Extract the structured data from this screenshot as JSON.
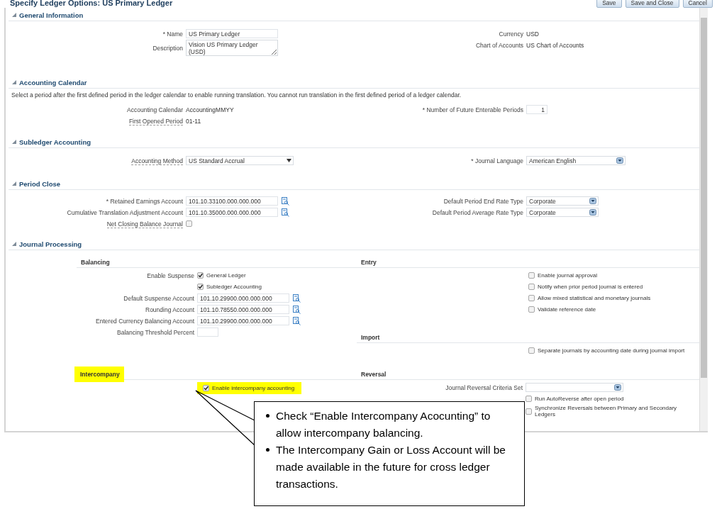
{
  "page": {
    "title": "Specify Ledger Options: US Primary Ledger",
    "buttons": [
      "Save",
      "Save and Close",
      "Cancel"
    ]
  },
  "general_information": {
    "title": "General Information",
    "left": [
      {
        "kind": "input",
        "label": "* Name",
        "value": "US Primary Ledger"
      },
      {
        "kind": "textarea",
        "label": "Description",
        "value": "Vision US Primary Ledger (USD)"
      }
    ],
    "right": [
      {
        "kind": "text",
        "label": "Currency",
        "value": "USD"
      },
      {
        "kind": "text",
        "label": "Chart of Accounts",
        "value": "US Chart of Accounts"
      }
    ]
  },
  "accounting_calendar": {
    "title": "Accounting Calendar",
    "note": "Select a period after the first defined period in the ledger calendar to enable running translation. You cannot run translation in the first defined period of a ledger calendar.",
    "left": [
      {
        "kind": "text",
        "label": "Accounting Calendar",
        "value": "AccountingMMYY"
      },
      {
        "kind": "text",
        "label": "First Opened Period",
        "value": "01-11",
        "hint": true
      }
    ],
    "right": [
      {
        "kind": "number",
        "label": "* Number of Future Enterable Periods",
        "value": "1"
      }
    ]
  },
  "subledger_accounting": {
    "title": "Subledger Accounting",
    "left": [
      {
        "kind": "select",
        "label": "Accounting Method",
        "value": "US Standard Accrual",
        "hint": true
      }
    ],
    "right": [
      {
        "kind": "combo",
        "label": "* Journal Language",
        "value": "American English"
      }
    ]
  },
  "period_close": {
    "title": "Period Close",
    "left": [
      {
        "kind": "lov",
        "label": "* Retained Earnings Account",
        "value": "101.10.33100.000.000.000"
      },
      {
        "kind": "lov",
        "label": "Cumulative Translation Adjustment Account",
        "value": "101.10.35000.000.000.000"
      },
      {
        "kind": "checkbox",
        "label": "Net Closing Balance Journal",
        "hint": true,
        "checked": false
      }
    ],
    "right": [
      {
        "kind": "combo",
        "label": "Default Period End Rate Type",
        "value": "Corporate"
      },
      {
        "kind": "combo",
        "label": "Default Period Average Rate Type",
        "value": "Corporate"
      }
    ]
  },
  "journal_processing": {
    "title": "Journal Processing",
    "balancing": {
      "title": "Balancing",
      "fields": [
        {
          "kind": "checkbox",
          "label": "Enable Suspense",
          "option": "General Ledger",
          "checked": true
        },
        {
          "kind": "checkbox",
          "option": "Subledger Accounting",
          "checked": true
        },
        {
          "kind": "lov",
          "label": "Default Suspense Account",
          "value": "101.10.29900.000.000.000"
        },
        {
          "kind": "lov",
          "label": "Rounding Account",
          "value": "101.10.78550.000.000.000"
        },
        {
          "kind": "lov",
          "label": "Entered Currency Balancing Account",
          "value": "101.10.29900.000.000.000"
        },
        {
          "kind": "number",
          "label": "Balancing Threshold Percent"
        }
      ]
    },
    "intercompany": {
      "title": "Intercompany",
      "highlighted": true,
      "fields": [
        {
          "kind": "checkbox",
          "option": "Enable intercompany accounting",
          "checked": true,
          "highlighted": true
        }
      ]
    },
    "entry": {
      "title": "Entry",
      "fields": [
        {
          "kind": "checkbox",
          "option": "Enable journal approval",
          "checked": false
        },
        {
          "kind": "checkbox",
          "option": "Notify when prior period journal is entered",
          "checked": false
        },
        {
          "kind": "checkbox",
          "option": "Allow mixed statistical and monetary journals",
          "checked": false
        },
        {
          "kind": "checkbox",
          "option": "Validate reference date",
          "checked": false
        }
      ]
    },
    "import": {
      "title": "Import",
      "fields": [
        {
          "kind": "checkbox",
          "option": "Separate journals by accounting date during journal import",
          "checked": false
        }
      ]
    },
    "reversal": {
      "title": "Reversal",
      "fields": [
        {
          "kind": "combo",
          "label": "Journal Reversal Criteria Set"
        },
        {
          "kind": "checkbox",
          "option": "Run AutoReverse after open period",
          "checked": false
        },
        {
          "kind": "checkbox",
          "option": "Synchronize Reversals between Primary and Secondary Ledgers",
          "checked": false
        }
      ]
    }
  },
  "callout": {
    "bullets": [
      "Check “Enable Intercompany Acocunting” to allow intercompany balancing.",
      "The Intercompany Gain or Loss Account will be made available in the future for cross ledger transactions."
    ]
  }
}
